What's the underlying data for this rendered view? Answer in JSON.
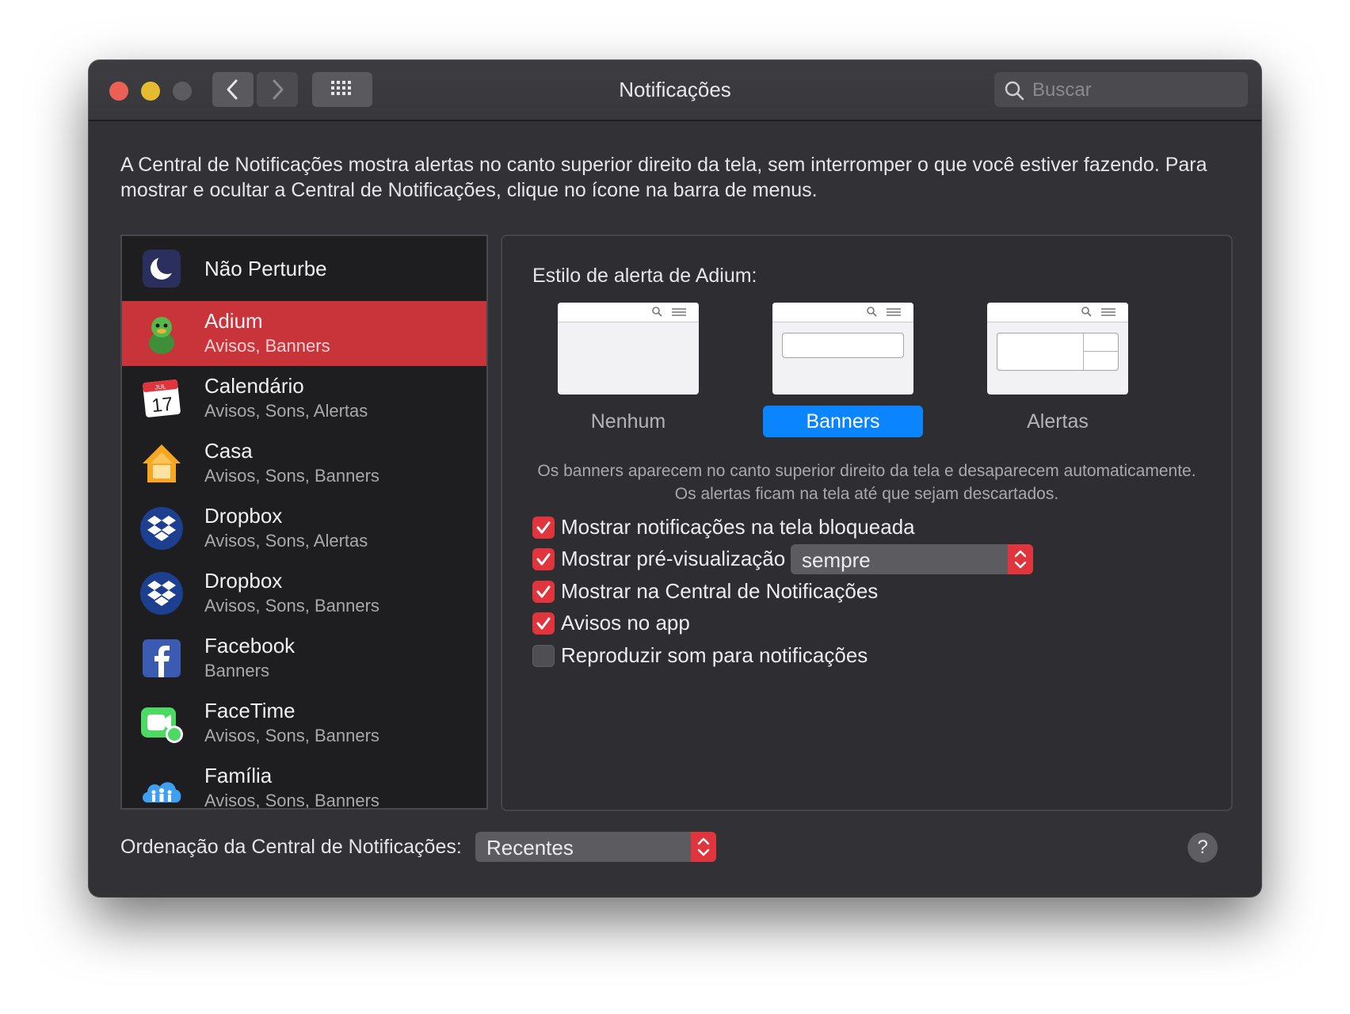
{
  "window": {
    "title": "Notificações",
    "search_placeholder": "Buscar"
  },
  "description": "A Central de Notificações mostra alertas no canto superior direito da tela, sem interromper o que você estiver fazendo. Para mostrar e ocultar a Central de Notificações, clique no ícone na barra de menus.",
  "apps": [
    {
      "name": "Não Perturbe",
      "subtitle": "",
      "icon": "moon-icon"
    },
    {
      "name": "Adium",
      "subtitle": "Avisos, Banners",
      "icon": "adium-duck-icon",
      "selected": true
    },
    {
      "name": "Calendário",
      "subtitle": "Avisos, Sons, Alertas",
      "icon": "calendar-icon",
      "icon_text_month": "JUL",
      "icon_text_day": "17"
    },
    {
      "name": "Casa",
      "subtitle": "Avisos, Sons, Banners",
      "icon": "home-icon"
    },
    {
      "name": "Dropbox",
      "subtitle": "Avisos, Sons, Alertas",
      "icon": "dropbox-icon"
    },
    {
      "name": "Dropbox",
      "subtitle": "Avisos, Sons, Banners",
      "icon": "dropbox-icon"
    },
    {
      "name": "Facebook",
      "subtitle": "Banners",
      "icon": "facebook-icon"
    },
    {
      "name": "FaceTime",
      "subtitle": "Avisos, Sons, Banners",
      "icon": "facetime-icon"
    },
    {
      "name": "Família",
      "subtitle": "Avisos, Sons, Banners",
      "icon": "family-icon"
    }
  ],
  "alert_style": {
    "heading": "Estilo de alerta de Adium:",
    "options": [
      "Nenhum",
      "Banners",
      "Alertas"
    ],
    "selected": "Banners",
    "help": "Os banners aparecem no canto superior direito da tela e desaparecem automaticamente. Os alertas ficam na tela até que sejam descartados."
  },
  "options": [
    {
      "label": "Mostrar notificações na tela bloqueada",
      "checked": true
    },
    {
      "label": "Mostrar pré-visualização",
      "checked": true
    },
    {
      "label": "Mostrar na Central de Notificações",
      "checked": true
    },
    {
      "label": "Avisos no app",
      "checked": true
    },
    {
      "label": "Reproduzir som para notificações",
      "checked": false
    }
  ],
  "preview_popup": {
    "value": "sempre"
  },
  "sort": {
    "label": "Ordenação da Central de Notificações:",
    "value": "Recentes"
  },
  "help_button": "?",
  "colors": {
    "accent_red": "#e0353d",
    "selection_red": "#c9343b",
    "accent_blue": "#0a84ff",
    "window_bg": "#323236"
  }
}
